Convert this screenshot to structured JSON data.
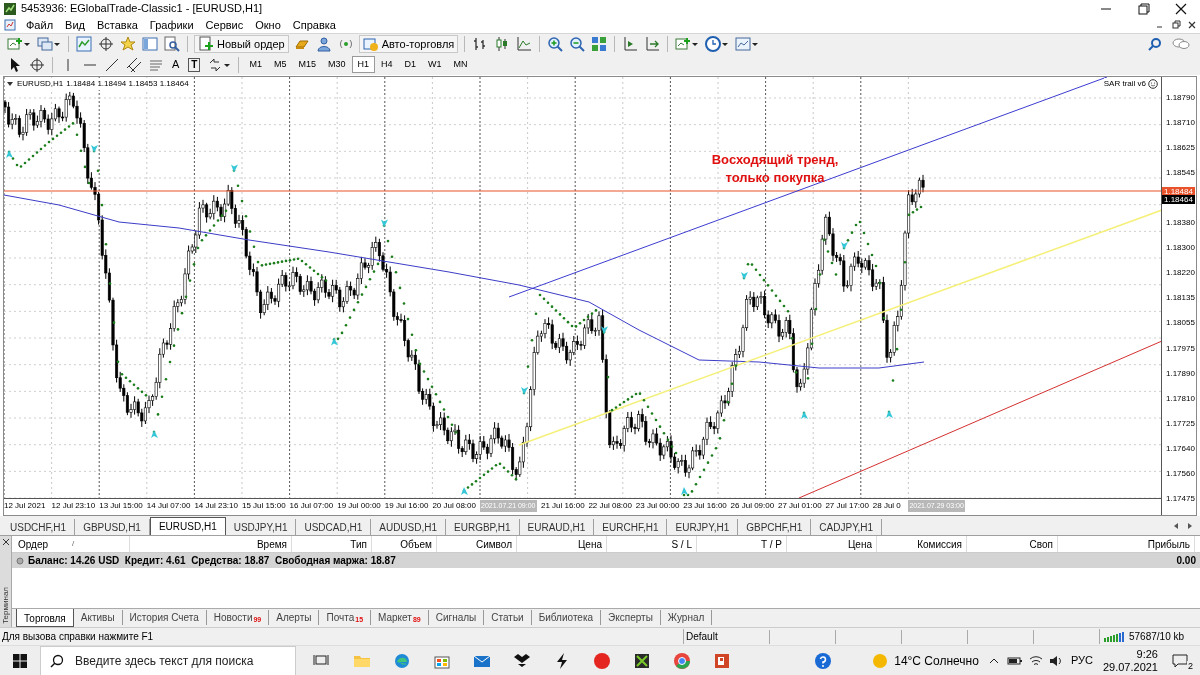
{
  "window": {
    "title": "5453936: EGlobalTrade-Classic1 - [EURUSD,H1]"
  },
  "menu": [
    "Файл",
    "Вид",
    "Вставка",
    "Графики",
    "Сервис",
    "Окно",
    "Справка"
  ],
  "toolbar_1": [
    {
      "kind": "icon-dropdown"
    },
    {
      "kind": "icon-dropdown"
    },
    {
      "kind": "separator"
    },
    {
      "kind": "icon"
    },
    {
      "kind": "icon"
    },
    {
      "kind": "icon"
    },
    {
      "kind": "icon"
    },
    {
      "kind": "icon"
    },
    {
      "kind": "separator"
    },
    {
      "kind": "button",
      "label": "Новый ордер"
    },
    {
      "kind": "icon"
    },
    {
      "kind": "icon"
    },
    {
      "kind": "icon"
    },
    {
      "kind": "button",
      "label": "Авто-торговля"
    },
    {
      "kind": "separator"
    },
    {
      "kind": "icon"
    },
    {
      "kind": "icon"
    },
    {
      "kind": "icon"
    },
    {
      "kind": "separator"
    },
    {
      "kind": "icon"
    },
    {
      "kind": "icon"
    },
    {
      "kind": "icon"
    },
    {
      "kind": "separator"
    },
    {
      "kind": "icon"
    },
    {
      "kind": "icon"
    },
    {
      "kind": "separator"
    },
    {
      "kind": "icon-dropdown"
    },
    {
      "kind": "icon-dropdown"
    },
    {
      "kind": "icon-dropdown"
    }
  ],
  "toolbar_2": [
    {
      "kind": "icon"
    },
    {
      "kind": "icon"
    },
    {
      "kind": "separator"
    },
    {
      "kind": "icon"
    },
    {
      "kind": "icon"
    },
    {
      "kind": "icon"
    },
    {
      "kind": "icon"
    },
    {
      "kind": "icon"
    },
    {
      "kind": "letter",
      "label": "A"
    },
    {
      "kind": "boxed-letter",
      "label": "T"
    },
    {
      "kind": "icon-dropdown"
    },
    {
      "kind": "separator"
    }
  ],
  "timeframes": [
    {
      "label": "M1",
      "selected": false
    },
    {
      "label": "M5",
      "selected": false
    },
    {
      "label": "M15",
      "selected": false
    },
    {
      "label": "M30",
      "selected": false
    },
    {
      "label": "H1",
      "selected": true
    },
    {
      "label": "H4",
      "selected": false
    },
    {
      "label": "D1",
      "selected": false
    },
    {
      "label": "W1",
      "selected": false
    },
    {
      "label": "MN",
      "selected": false
    }
  ],
  "chart": {
    "symbol": "EURUSD,H1",
    "ohlc": "1.18484 1.18494 1.18453 1.18464",
    "indicator": "SAR trail v6",
    "annotation": "Восходящий тренд, только покупка",
    "price_labels": [
      "1.18790",
      "1.18710",
      "1.18625",
      "1.18545",
      "1.18380",
      "1.18300",
      "1.18220",
      "1.18135",
      "1.18055",
      "1.17975",
      "1.17890",
      "1.17810",
      "1.17725",
      "1.17640",
      "1.17560",
      "1.17475"
    ],
    "price_tags": [
      {
        "text": "1.18484",
        "color": "#e8532b"
      },
      {
        "text": "1.18464",
        "color": "#000000"
      }
    ],
    "time_labels": [
      {
        "text": "12 Jul 2021",
        "kind": "label"
      },
      {
        "text": "12 Jul 23:10",
        "kind": "label"
      },
      {
        "text": "13 Jul 15:00",
        "kind": "label"
      },
      {
        "text": "14 Jul 07:00",
        "kind": "label"
      },
      {
        "text": "14 Jul 23:10",
        "kind": "label"
      },
      {
        "text": "15 Jul 15:00",
        "kind": "label"
      },
      {
        "text": "16 Jul 07:00",
        "kind": "label"
      },
      {
        "text": "19 Jul 00:00",
        "kind": "label"
      },
      {
        "text": "19 Jul 16:00",
        "kind": "label"
      },
      {
        "text": "20 Jul 08:00",
        "kind": "label"
      },
      {
        "text": "2021.07.21 09:00",
        "kind": "marker"
      },
      {
        "text": "21 Jul 16:00",
        "kind": "label"
      },
      {
        "text": "22 Jul 08:00",
        "kind": "label"
      },
      {
        "text": "23 Jul 00:00",
        "kind": "label"
      },
      {
        "text": "23 Jul 16:00",
        "kind": "label"
      },
      {
        "text": "26 Jul 09:00",
        "kind": "label"
      },
      {
        "text": "27 Jul 01:00",
        "kind": "label"
      },
      {
        "text": "27 Jul 17:00",
        "kind": "label"
      },
      {
        "text": "28 Jul 0",
        "kind": "label"
      },
      {
        "text": "2021.07.29 03:00",
        "kind": "marker"
      }
    ]
  },
  "symbol_tabs": [
    {
      "label": "USDCHF,H1",
      "selected": false
    },
    {
      "label": "GBPUSD,H1",
      "selected": false
    },
    {
      "label": "EURUSD,H1",
      "selected": true
    },
    {
      "label": "USDJPY,H1",
      "selected": false
    },
    {
      "label": "USDCAD,H1",
      "selected": false
    },
    {
      "label": "AUDUSD,H1",
      "selected": false
    },
    {
      "label": "EURGBP,H1",
      "selected": false
    },
    {
      "label": "EURAUD,H1",
      "selected": false
    },
    {
      "label": "EURCHF,H1",
      "selected": false
    },
    {
      "label": "EURJPY,H1",
      "selected": false
    },
    {
      "label": "GBPCHF,H1",
      "selected": false
    },
    {
      "label": "CADJPY,H1",
      "selected": false
    }
  ],
  "terminal": {
    "title": "Терминал",
    "sort_mark": "/",
    "columns": [
      "Ордер",
      "Время",
      "Тип",
      "Объем",
      "Символ",
      "Цена",
      "S / L",
      "T / P",
      "Цена",
      "Комиссия",
      "Своп",
      "Прибыль"
    ],
    "balance": "Баланс: 14.26 USD  Кредит: 4.61  Средства: 18.87  Свободная маржа: 18.87",
    "profit": "0.00",
    "tabs": [
      {
        "label": "Торговля",
        "selected": true
      },
      {
        "label": "Активы",
        "selected": false
      },
      {
        "label": "История Счета",
        "selected": false
      },
      {
        "label": "Новости",
        "badge": "99",
        "selected": false
      },
      {
        "label": "Алерты",
        "selected": false
      },
      {
        "label": "Почта",
        "badge": "15",
        "selected": false
      },
      {
        "label": "Маркет",
        "badge": "89",
        "selected": false
      },
      {
        "label": "Сигналы",
        "selected": false
      },
      {
        "label": "Статьи",
        "selected": false
      },
      {
        "label": "Библиотека",
        "selected": false
      },
      {
        "label": "Эксперты",
        "selected": false
      },
      {
        "label": "Журнал",
        "selected": false
      }
    ]
  },
  "status_bar": {
    "help": "Для вызова справки нажмите F1",
    "profile": "Default",
    "traffic": "57687/10 kb"
  },
  "taskbar": {
    "search_placeholder": "Введите здесь текст для поиска",
    "weather": "14°C Солнечно",
    "language": "РУС",
    "time": "9:26",
    "date": "29.07.2021",
    "notifications": "2"
  }
}
